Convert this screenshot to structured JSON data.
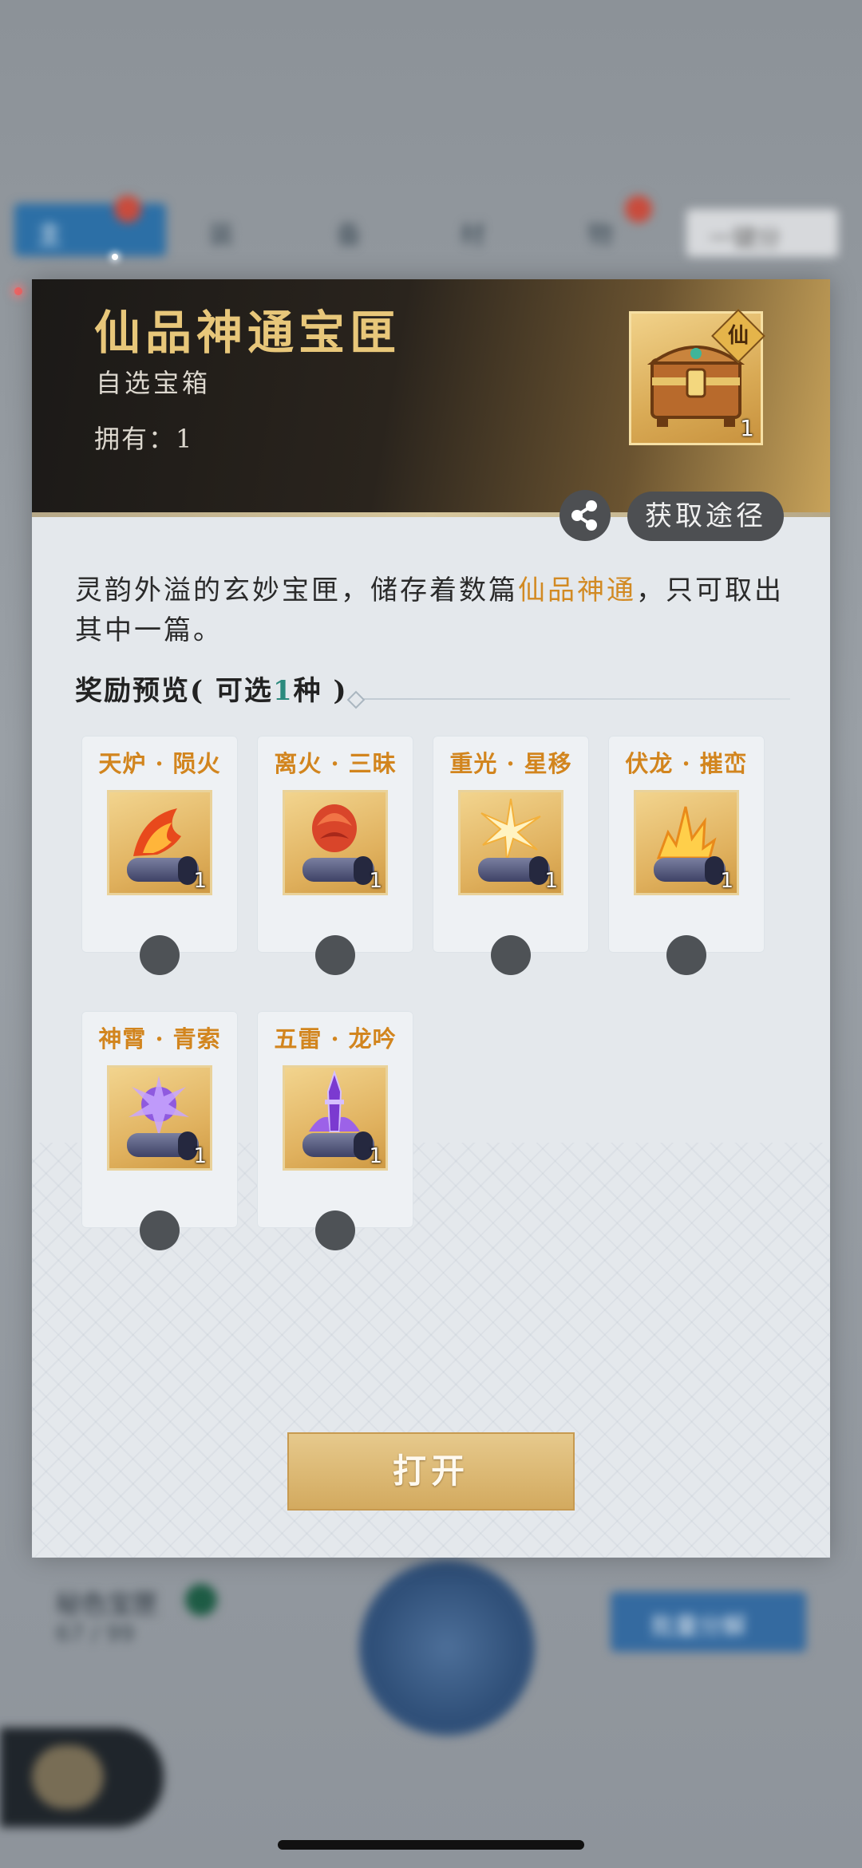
{
  "background": {
    "tabs": [
      "主",
      "装",
      "备",
      "材",
      "物"
    ],
    "right_button": "一键分",
    "progress_label": "秘色宝匣",
    "progress_value": "67 / 99",
    "action_button": "批量分解"
  },
  "dialog": {
    "title": "仙品神通宝匣",
    "subtitle": "自选宝箱",
    "owned": "拥有：1",
    "item_badge": "仙",
    "item_count": "1",
    "source_button": "获取途径",
    "description_parts": [
      "灵韵外溢的玄妙宝匣，储存着数篇",
      "仙品神通",
      "，只可取出其中一篇。"
    ],
    "reward_title_prefix": "奖励预览( 可选",
    "reward_title_num": "1",
    "reward_title_suffix": "种 )",
    "rewards": [
      {
        "name": "天炉 · 陨火",
        "count": "1",
        "icon": "flame-scroll-icon"
      },
      {
        "name": "离火 · 三昧",
        "count": "1",
        "icon": "fire-lotus-scroll-icon"
      },
      {
        "name": "重光 · 星移",
        "count": "1",
        "icon": "star-burst-scroll-icon"
      },
      {
        "name": "伏龙 · 摧峦",
        "count": "1",
        "icon": "golden-flame-scroll-icon"
      },
      {
        "name": "神霄 · 青索",
        "count": "1",
        "icon": "purple-lightning-scroll-icon"
      },
      {
        "name": "五雷 · 龙吟",
        "count": "1",
        "icon": "purple-sword-scroll-icon"
      }
    ],
    "open_button": "打开"
  },
  "colors": {
    "accent_gold": "#e8c77a",
    "highlight_orange": "#d28a23",
    "number_teal": "#2b8a7d"
  }
}
